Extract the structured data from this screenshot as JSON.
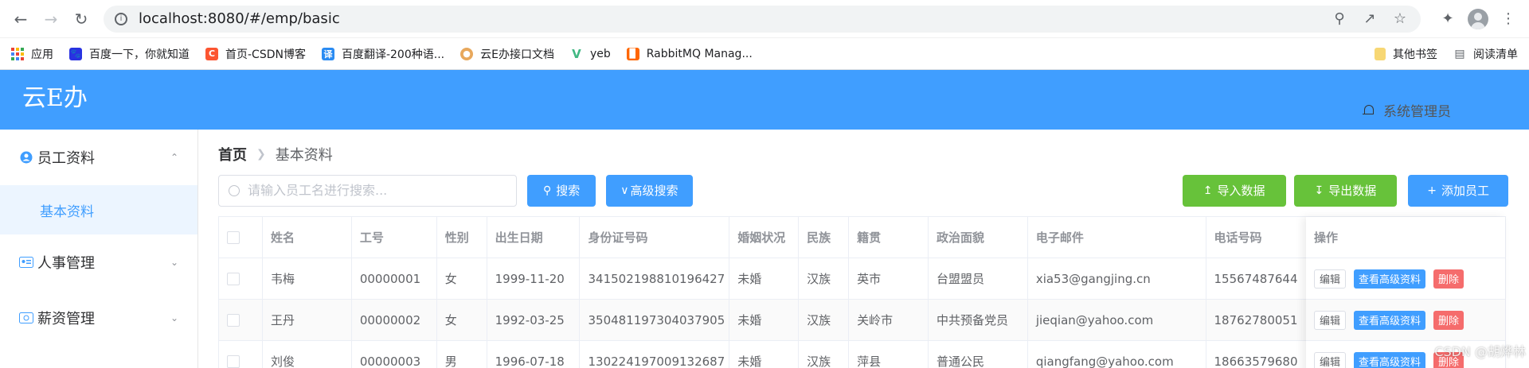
{
  "browser": {
    "url": "localhost:8080/#/emp/basic",
    "bookmarks": [
      {
        "label": "应用",
        "color": "#ea4335"
      },
      {
        "label": "百度一下，你就知道",
        "color": "#2932e1"
      },
      {
        "label": "首页-CSDN博客",
        "color": "#fc5531"
      },
      {
        "label": "百度翻译-200种语...",
        "color": "#2a8bf2"
      },
      {
        "label": "云E办接口文档",
        "color": "#e8a85c"
      },
      {
        "label": "yeb",
        "color": "#41b883"
      },
      {
        "label": "RabbitMQ Manag...",
        "color": "#ff6600"
      }
    ],
    "other_bookmarks": "其他书签",
    "reading_list": "阅读清单"
  },
  "header": {
    "title": "云E办",
    "user": "系统管理员",
    "brand_color": "#409eff"
  },
  "sidebar": {
    "groups": [
      {
        "label": "员工资料",
        "expanded": true
      },
      {
        "label": "人事管理",
        "expanded": false
      },
      {
        "label": "薪资管理",
        "expanded": false
      }
    ],
    "active_item": "基本资料"
  },
  "breadcrumb": {
    "home": "首页",
    "current": "基本资料"
  },
  "toolbar": {
    "search_placeholder": "请输入员工名进行搜索...",
    "search_label": "搜索",
    "advanced_label": "高级搜索",
    "import_label": "导入数据",
    "export_label": "导出数据",
    "add_label": "添加员工"
  },
  "table": {
    "columns": [
      "姓名",
      "工号",
      "性别",
      "出生日期",
      "身份证号码",
      "婚姻状况",
      "民族",
      "籍贯",
      "政治面貌",
      "电子邮件",
      "电话号码"
    ],
    "ops_header": "操作",
    "ops_labels": {
      "edit": "编辑",
      "detail": "查看高级资料",
      "delete": "删除"
    },
    "rows": [
      [
        "韦梅",
        "00000001",
        "女",
        "1999-11-20",
        "341502198810196427",
        "未婚",
        "汉族",
        "英市",
        "台盟盟员",
        "xia53@gangjing.cn",
        "15567487644"
      ],
      [
        "王丹",
        "00000002",
        "女",
        "1992-03-25",
        "350481197304037905",
        "未婚",
        "汉族",
        "关岭市",
        "中共预备党员",
        "jieqian@yahoo.com",
        "18762780051"
      ],
      [
        "刘俊",
        "00000003",
        "男",
        "1996-07-18",
        "130224197009132687",
        "未婚",
        "汉族",
        "萍县",
        "普通公民",
        "qiangfang@yahoo.com",
        "18663579680"
      ]
    ]
  },
  "watermark": "CSDN @胡烨林"
}
